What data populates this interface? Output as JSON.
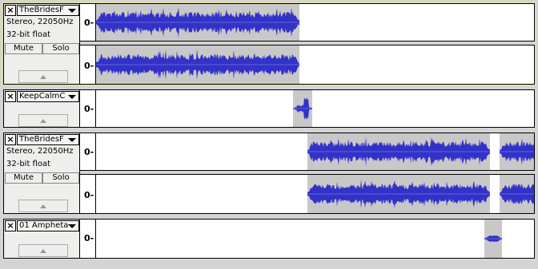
{
  "tracks": [
    {
      "name": "TheBridesF",
      "info1": "Stereo, 22050Hz",
      "info2": "32-bit float",
      "mute_label": "Mute",
      "solo_label": "Solo",
      "close_label": "×",
      "scale_label": "0-",
      "selected": true
    },
    {
      "name": "KeepCalmC",
      "close_label": "×",
      "scale_label": "0-"
    },
    {
      "name": "TheBridesF",
      "info1": "Stereo, 22050Hz",
      "info2": "32-bit float",
      "mute_label": "Mute",
      "solo_label": "Solo",
      "close_label": "×",
      "scale_label": "0-"
    },
    {
      "name": "01 Ampheta",
      "close_label": "×",
      "scale_label": "0-"
    }
  ],
  "colors": {
    "waveform": "#3232c8",
    "waveform_rms": "#6464dc",
    "clip_bg": "#c8c8c8",
    "track_bg": "#ffffff",
    "selected_border": "#e5e58a"
  }
}
